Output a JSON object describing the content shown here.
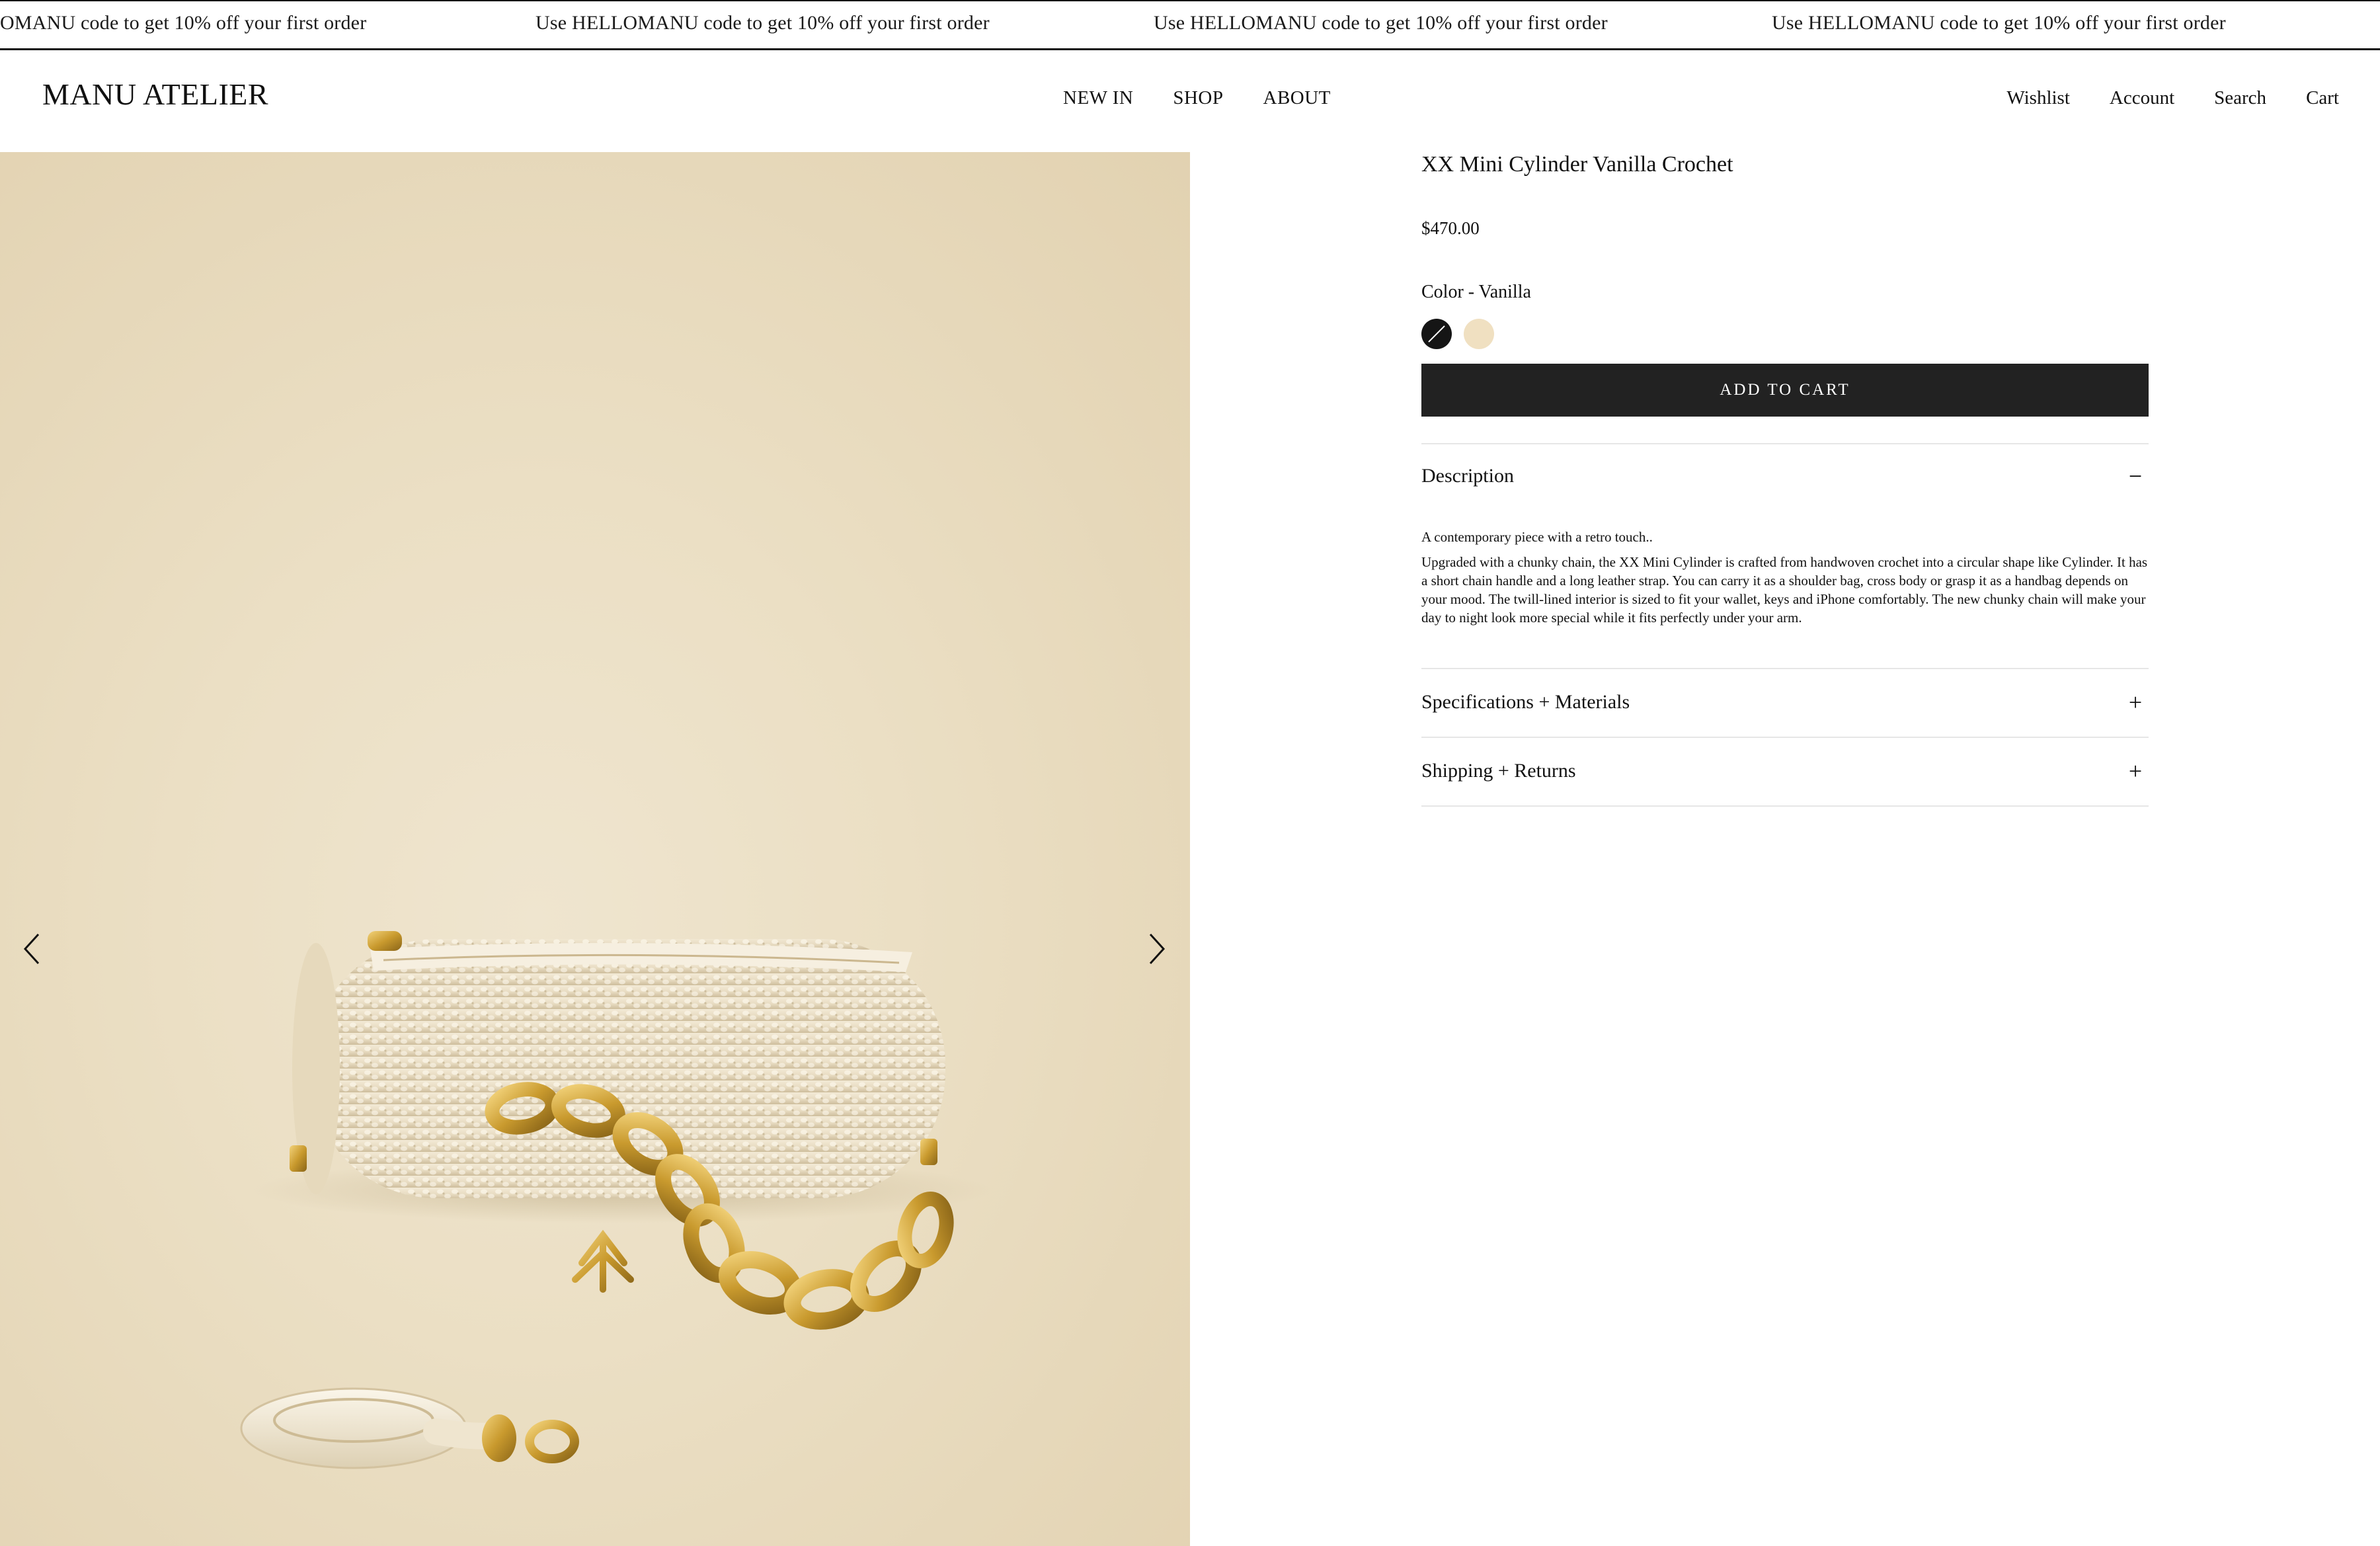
{
  "announcement": {
    "messages": [
      "OMANU code to get 10% off your first order",
      "Use HELLOMANU code to get 10% off your first order",
      "Use HELLOMANU code to get 10% off your first order",
      "Use HELLOMANU code to get 10% off your first order"
    ]
  },
  "header": {
    "logo": "MANU ATELIER",
    "nav": [
      "NEW IN",
      "SHOP",
      "ABOUT"
    ],
    "utility": [
      "Wishlist",
      "Account",
      "Search",
      "Cart"
    ]
  },
  "product": {
    "title": "XX Mini Cylinder Vanilla Crochet",
    "price": "$470.00",
    "color_label": "Color - Vanilla",
    "swatches": [
      {
        "name": "Black",
        "color": "#151515"
      },
      {
        "name": "Vanilla",
        "color": "#f0e0c1"
      }
    ],
    "add_to_cart": "ADD TO CART"
  },
  "accordions": {
    "description": {
      "title": "Description",
      "sign": "−",
      "intro": "A contemporary piece with a retro touch..",
      "body": "Upgraded with a chunky chain, the XX Mini Cylinder is crafted from handwoven crochet into a circular shape like Cylinder. It has a short chain handle and a long leather strap. You can carry it as a shoulder bag, cross body or grasp it as a handbag depends on your mood. The twill-lined interior is sized to fit your wallet, keys and iPhone comfortably. The new chunky chain will make your day to night look more special while it fits perfectly under your arm."
    },
    "specs": {
      "title": "Specifications + Materials",
      "sign": "+"
    },
    "shipping": {
      "title": "Shipping + Returns",
      "sign": "+"
    }
  },
  "colors": {
    "accent": "#222222",
    "gold": "#c99a2e",
    "cream": "#efe5cf"
  }
}
